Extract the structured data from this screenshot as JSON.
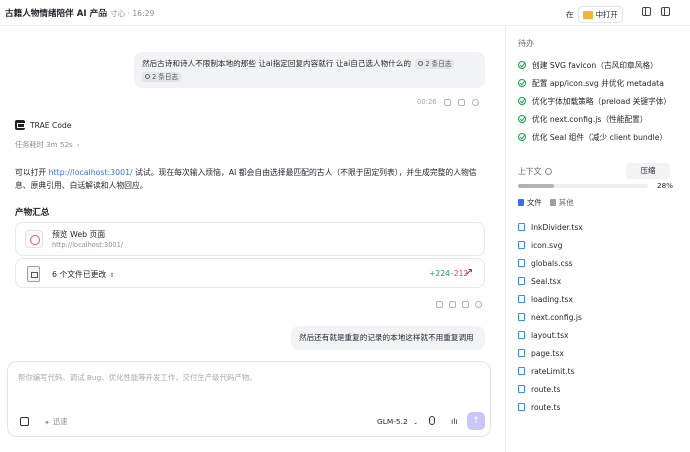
{
  "header": {
    "title": "古籍人物情绪陪伴 AI 产品",
    "meta": "寸心 · 16:29",
    "open_in_prefix": "在",
    "open_button_label": "中打开"
  },
  "chat": {
    "user_message_1": "然后古诗和诗人不限制本地的那些 让ai指定回复内容就行 让ai自己选人物什么的",
    "log_badge_1": "2 条日志",
    "log_badge_2": "2 条日志",
    "message_time": "00:26",
    "assistant_name": "TRAE Code",
    "duration": "任务耗时 3m 52s",
    "answer_prefix": "可以打开 ",
    "answer_link": "http://localhost:3001/",
    "answer_suffix": " 试试。现在每次输入烦恼，AI 都会自由选择最匹配的古人（不限于固定列表），并生成完整的人物信息、原典引用、白话解读和人物回应。",
    "products_title": "产物汇总",
    "preview_title": "预览 Web 页面",
    "preview_url": "http://localhost:3001/",
    "files_changed": "6 个文件已更改",
    "diff_add": "+224",
    "diff_del": "-212",
    "user_message_2": "然后还有就是重复的记录的本地这样就不用重复调用"
  },
  "input": {
    "placeholder": "帮你编写代码、调试 Bug、优化性能等开发工作，交付生产级代码产物。",
    "speed_label": "迅速",
    "model_label": "GLM-5.2"
  },
  "todo": {
    "title": "待办",
    "items": [
      "创建 SVG favicon（古风印章风格）",
      "配置 app/icon.svg 并优化 metadata",
      "优化字体加载策略（preload 关键字体）",
      "优化 next.config.js（性能配置）",
      "优化 Seal 组件（减少 client bundle）"
    ]
  },
  "context": {
    "label": "上下文",
    "compress_label": "压缩",
    "usage_percent": "28%",
    "usage_fraction": 0.28,
    "tab_files": "文件",
    "tab_other": "其他",
    "files": [
      "InkDivider.tsx",
      "icon.svg",
      "globals.css",
      "Seal.tsx",
      "loading.tsx",
      "next.config.js",
      "layout.tsx",
      "page.tsx",
      "rateLimit.ts",
      "route.ts",
      "route.ts"
    ]
  },
  "colors": {
    "accent": "#3370ff",
    "success": "#17a34a",
    "danger": "#e5484d",
    "send_button": "#c9c7f8"
  }
}
